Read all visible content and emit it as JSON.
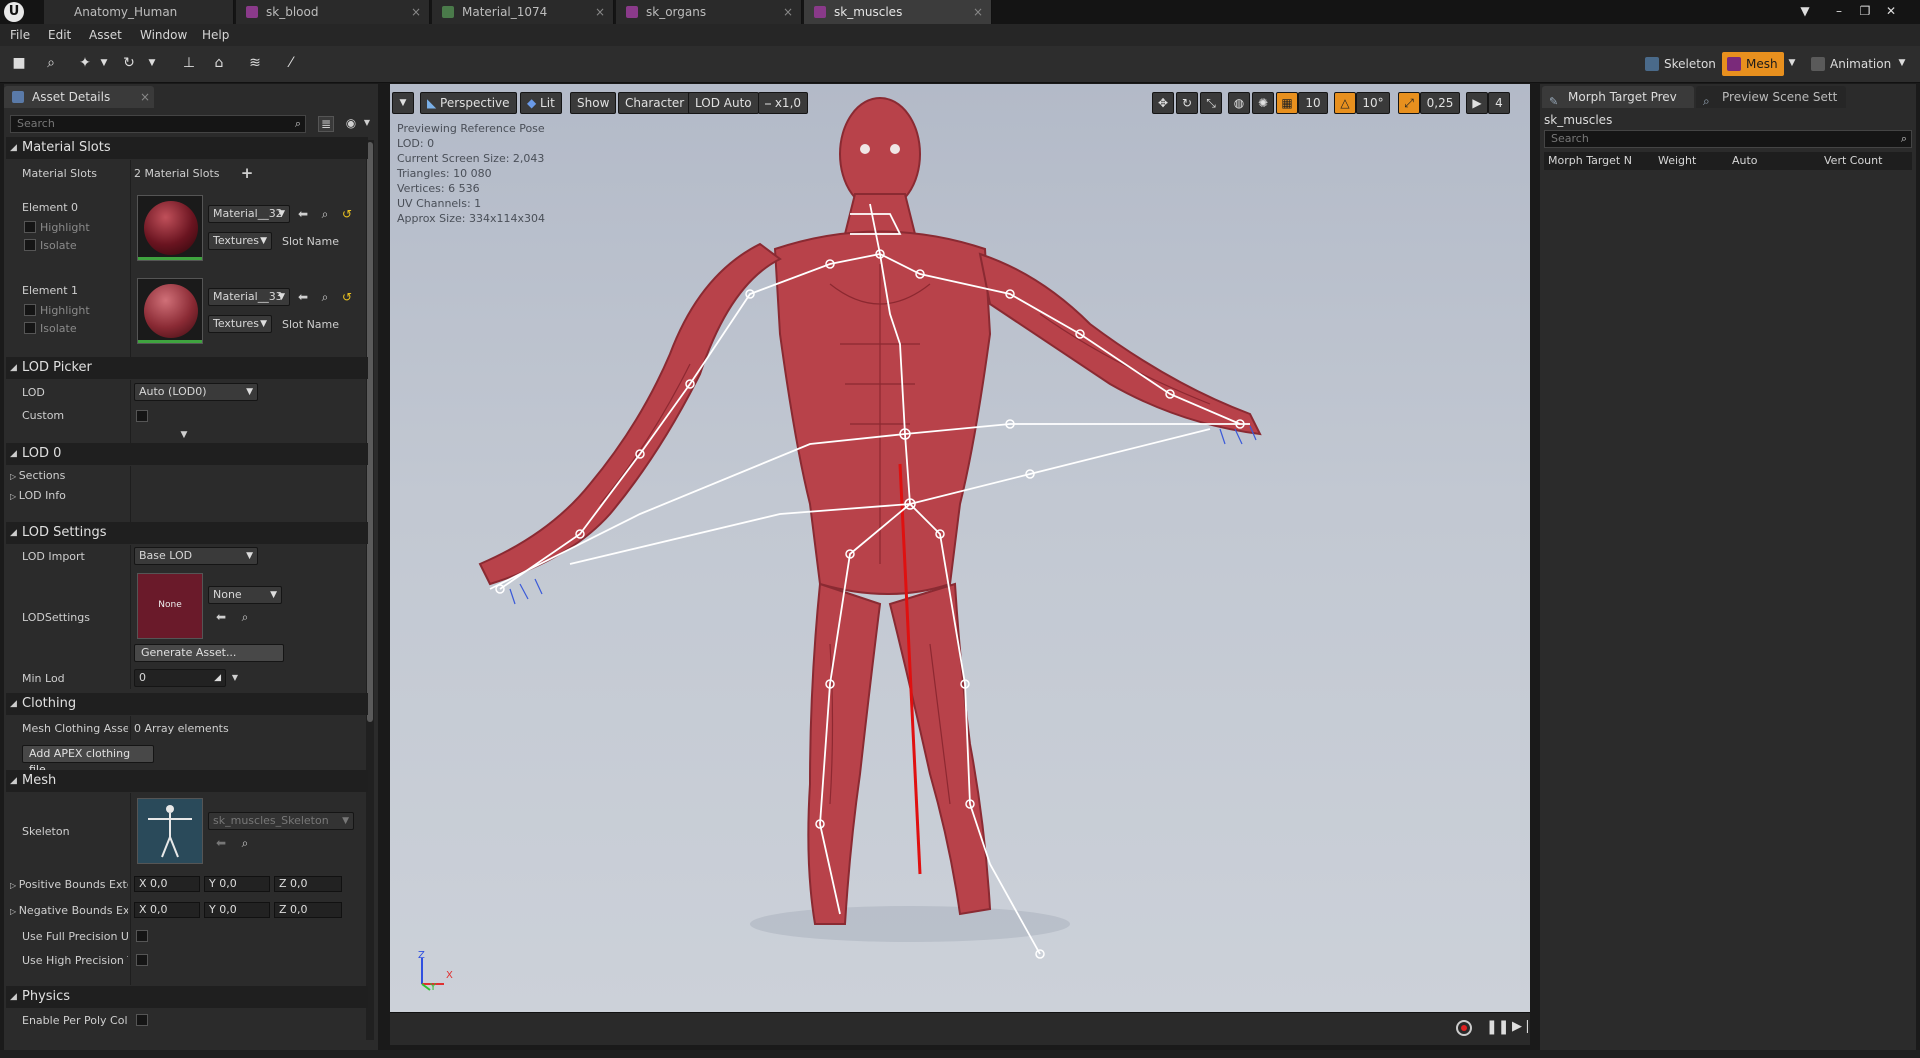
{
  "tabs": [
    {
      "label": "Anatomy_Human"
    },
    {
      "label": "sk_blood"
    },
    {
      "label": "Material_1074"
    },
    {
      "label": "sk_organs"
    },
    {
      "label": "sk_muscles"
    }
  ],
  "menu": [
    "File",
    "Edit",
    "Asset",
    "Window",
    "Help"
  ],
  "modes": {
    "skeleton": "Skeleton",
    "mesh": "Mesh",
    "animation": "Animation"
  },
  "left_panel": {
    "tab": "Asset Details",
    "search_placeholder": "Search",
    "material_slots": {
      "header": "Material Slots",
      "label": "Material Slots",
      "count": "2 Material Slots",
      "elements": [
        {
          "name": "Element 0",
          "highlight": "Highlight",
          "isolate": "Isolate",
          "material": "Material__32",
          "textures": "Textures",
          "slot_name": "Slot Name"
        },
        {
          "name": "Element 1",
          "highlight": "Highlight",
          "isolate": "Isolate",
          "material": "Material__33",
          "textures": "Textures",
          "slot_name": "Slot Name"
        }
      ]
    },
    "lod_picker": {
      "header": "LOD Picker",
      "lod_label": "LOD",
      "lod_value": "Auto (LOD0)",
      "custom_label": "Custom"
    },
    "lod0": {
      "header": "LOD 0",
      "sections": "Sections",
      "lod_info": "LOD Info"
    },
    "lod_settings": {
      "header": "LOD Settings",
      "lod_import_label": "LOD Import",
      "lod_import_value": "Base LOD",
      "lodsettings_label": "LODSettings",
      "thumb_text": "None",
      "none_combo": "None",
      "generate_button": "Generate Asset...",
      "min_lod_label": "Min Lod",
      "min_lod_value": "0"
    },
    "clothing": {
      "header": "Clothing",
      "label": "Mesh Clothing Asset:",
      "value": "0 Array elements",
      "button": "Add APEX clothing file..."
    },
    "mesh": {
      "header": "Mesh",
      "skeleton_label": "Skeleton",
      "skeleton_value": "sk_muscles_Skeleton",
      "pos_bounds_label": "Positive Bounds Exte",
      "neg_bounds_label": "Negative Bounds Exte",
      "x_label": "X",
      "y_label": "Y",
      "z_label": "Z",
      "vec_value": "0,0",
      "full_precision_label": "Use Full Precision UV",
      "high_precision_label": "Use High Precision Ta"
    },
    "physics": {
      "header": "Physics",
      "enable_label": "Enable Per Poly Collis"
    }
  },
  "viewport": {
    "perspective": "Perspective",
    "lit": "Lit",
    "show": "Show",
    "character": "Character",
    "lod_auto": "LOD Auto",
    "speed": "x1,0",
    "grid_value": "10",
    "angle_value": "10°",
    "scale_value": "0,25",
    "camera_speed": "4",
    "stats": [
      "Previewing Reference Pose",
      "LOD: 0",
      "Current Screen Size: 2,043",
      "Triangles: 10 080",
      "Vertices: 6 536",
      "UV Channels: 1",
      "Approx Size: 334x114x304"
    ],
    "axis_z": "Z",
    "axis_x": "X",
    "axis_y": "Y"
  },
  "right_panel": {
    "tab1": "Morph Target Prev",
    "tab2": "Preview Scene Sett",
    "asset": "sk_muscles",
    "search_placeholder": "Search",
    "columns": [
      "Morph Target N",
      "Weight",
      "Auto",
      "Vert Count"
    ]
  },
  "colors": {
    "accent_orange": "#e8901e",
    "mesh_skin": "#b8424a",
    "bone": "#ffffff",
    "root_line": "#e01010"
  }
}
